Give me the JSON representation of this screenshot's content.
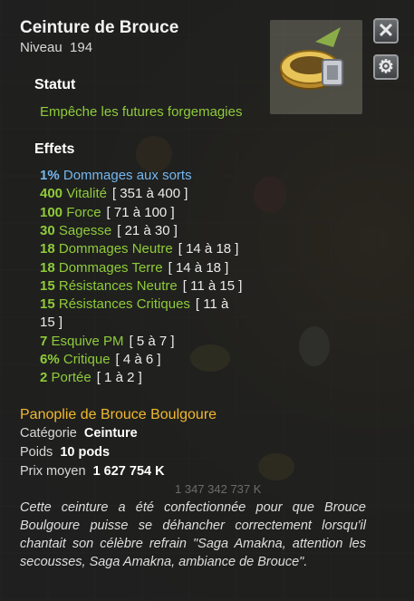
{
  "item": {
    "name": "Ceinture de Brouce",
    "level_label": "Niveau",
    "level": "194"
  },
  "statut": {
    "heading": "Statut",
    "text": "Empêche les futures forgemagies"
  },
  "effets": {
    "heading": "Effets",
    "lines": [
      {
        "value": "1%",
        "label": "Dommages aux sorts",
        "range": "",
        "color": "#74b7f0"
      },
      {
        "value": "400",
        "label": "Vitalité",
        "range": "[ 351 à 400 ]",
        "color": "#8fcb3a"
      },
      {
        "value": "100",
        "label": "Force",
        "range": "[ 71 à 100 ]",
        "color": "#8fcb3a"
      },
      {
        "value": "30",
        "label": "Sagesse",
        "range": "[ 21 à 30 ]",
        "color": "#8fcb3a"
      },
      {
        "value": "18",
        "label": "Dommages Neutre",
        "range": "[ 14 à 18 ]",
        "color": "#8fcb3a"
      },
      {
        "value": "18",
        "label": "Dommages Terre",
        "range": "[ 14 à 18 ]",
        "color": "#8fcb3a"
      },
      {
        "value": "15",
        "label": "Résistances Neutre",
        "range": "[ 11 à 15 ]",
        "color": "#8fcb3a"
      },
      {
        "value": "15",
        "label": "Résistances Critiques",
        "range": "[ 11 à",
        "color": "#8fcb3a"
      },
      {
        "value": "",
        "label": "",
        "range": "15 ]",
        "color": "#8fcb3a"
      },
      {
        "value": "7",
        "label": "Esquive PM",
        "range": "[ 5 à 7 ]",
        "color": "#8fcb3a"
      },
      {
        "value": "6%",
        "label": "Critique",
        "range": "[ 4 à 6 ]",
        "color": "#8fcb3a"
      },
      {
        "value": "2",
        "label": "Portée",
        "range": "[ 1 à 2 ]",
        "color": "#8fcb3a"
      }
    ]
  },
  "info": {
    "set_name": "Panoplie de Brouce Boulgoure",
    "category_label": "Catégorie",
    "category": "Ceinture",
    "weight_label": "Poids",
    "weight": "10 pods",
    "price_label": "Prix moyen",
    "price": "1 627 754 K",
    "background_price": "1 347 342 737 K"
  },
  "description": "Cette ceinture a été confectionnée pour que Brouce Boulgoure puisse se déhancher correctement lorsqu'il chantait son célèbre refrain \"Saga Amakna, attention les secousses, Saga Amakna, ambiance de Brouce\".",
  "buttons": {
    "close_icon": "✕",
    "settings_icon": "⚙"
  },
  "colors": {
    "effect_green": "#8fcb3a",
    "effect_blue": "#74b7f0",
    "set_gold": "#f1b82f"
  }
}
